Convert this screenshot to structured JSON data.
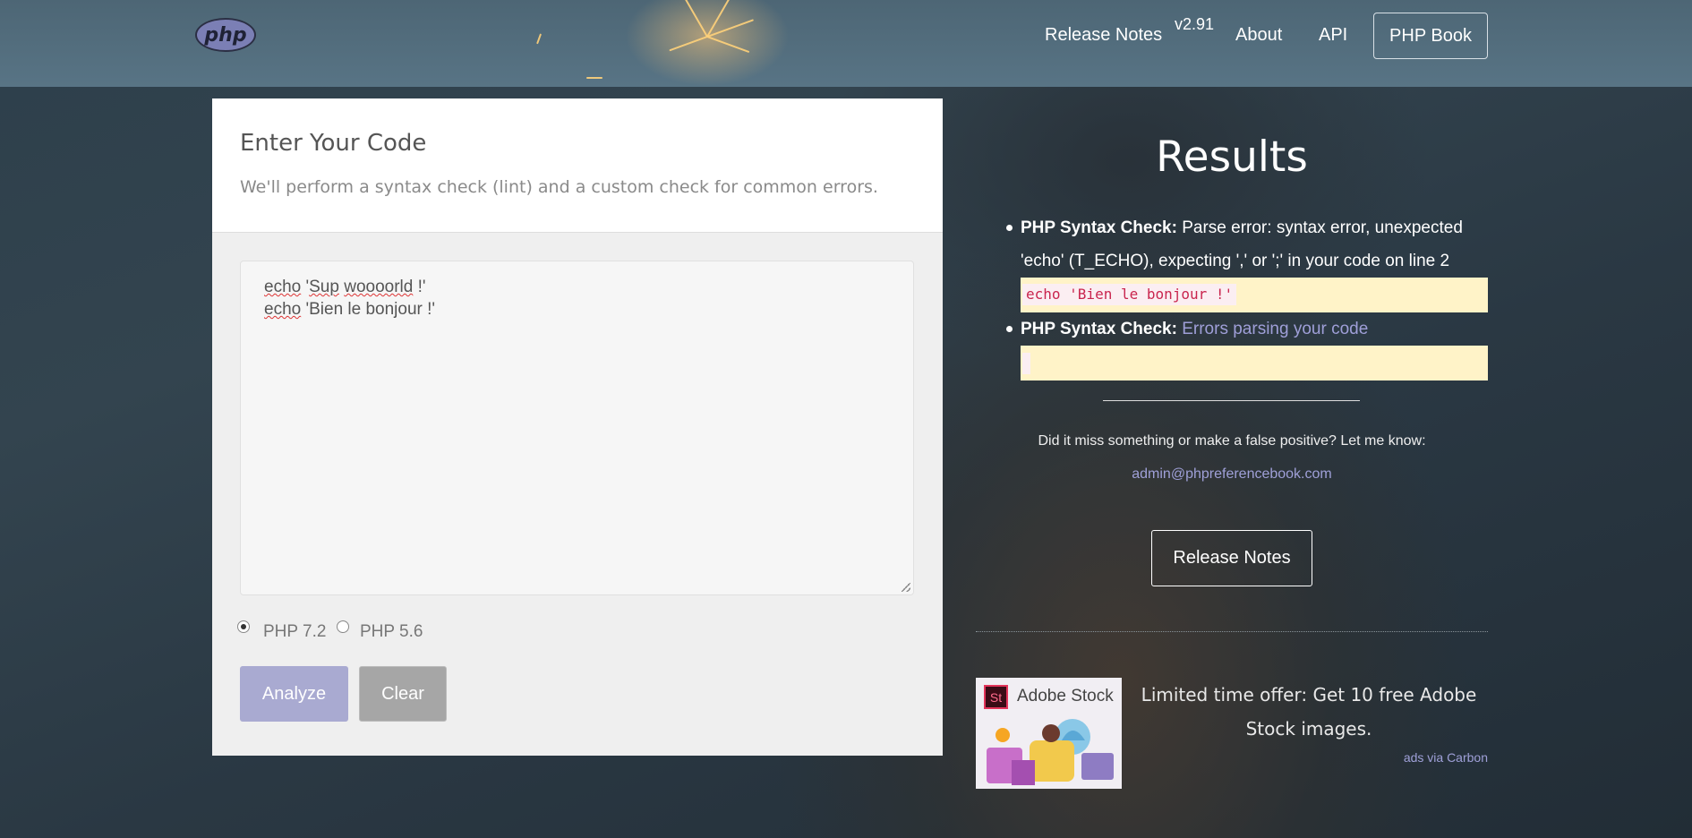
{
  "header": {
    "logo_text": "php",
    "nav": {
      "release_notes": "Release Notes",
      "version": "v2.91",
      "about": "About",
      "api": "API",
      "book": "PHP Book"
    }
  },
  "editor": {
    "title": "Enter Your Code",
    "subtitle": "We'll perform a syntax check (lint) and a custom check for common errors.",
    "code_lines": [
      {
        "kw": "echo",
        "q1": "'",
        "w1": "Sup",
        "sp": " ",
        "w2": "woooorld",
        "rest": " !'"
      },
      {
        "kw": "echo",
        "rest": " 'Bien le bonjour !'"
      }
    ],
    "versions": [
      {
        "label": "PHP 7.2",
        "selected": true
      },
      {
        "label": "PHP 5.6",
        "selected": false
      }
    ],
    "analyze_label": "Analyze",
    "clear_label": "Clear"
  },
  "results": {
    "title": "Results",
    "items": [
      {
        "label": "PHP Syntax Check:",
        "message": "Parse error: syntax error, unexpected 'echo' (T_ECHO), expecting ',' or ';' in your code on line 2",
        "snippet": "echo 'Bien le bonjour !'"
      },
      {
        "label": "PHP Syntax Check:",
        "message": "Errors parsing your code",
        "snippet": ""
      }
    ],
    "feedback": "Did it miss something or make a false positive? Let me know:",
    "email": "admin@phpreferencebook.com",
    "release_notes_button": "Release Notes"
  },
  "ad": {
    "brand": "Adobe Stock",
    "badge": "St",
    "text": "Limited time offer: Get 10 free Adobe Stock images.",
    "via": "ads via Carbon"
  },
  "colors": {
    "accent": "#a9aad1",
    "link": "#9f9fd8",
    "snippet_bg": "#fff3c8",
    "code_red": "#c9254e"
  }
}
